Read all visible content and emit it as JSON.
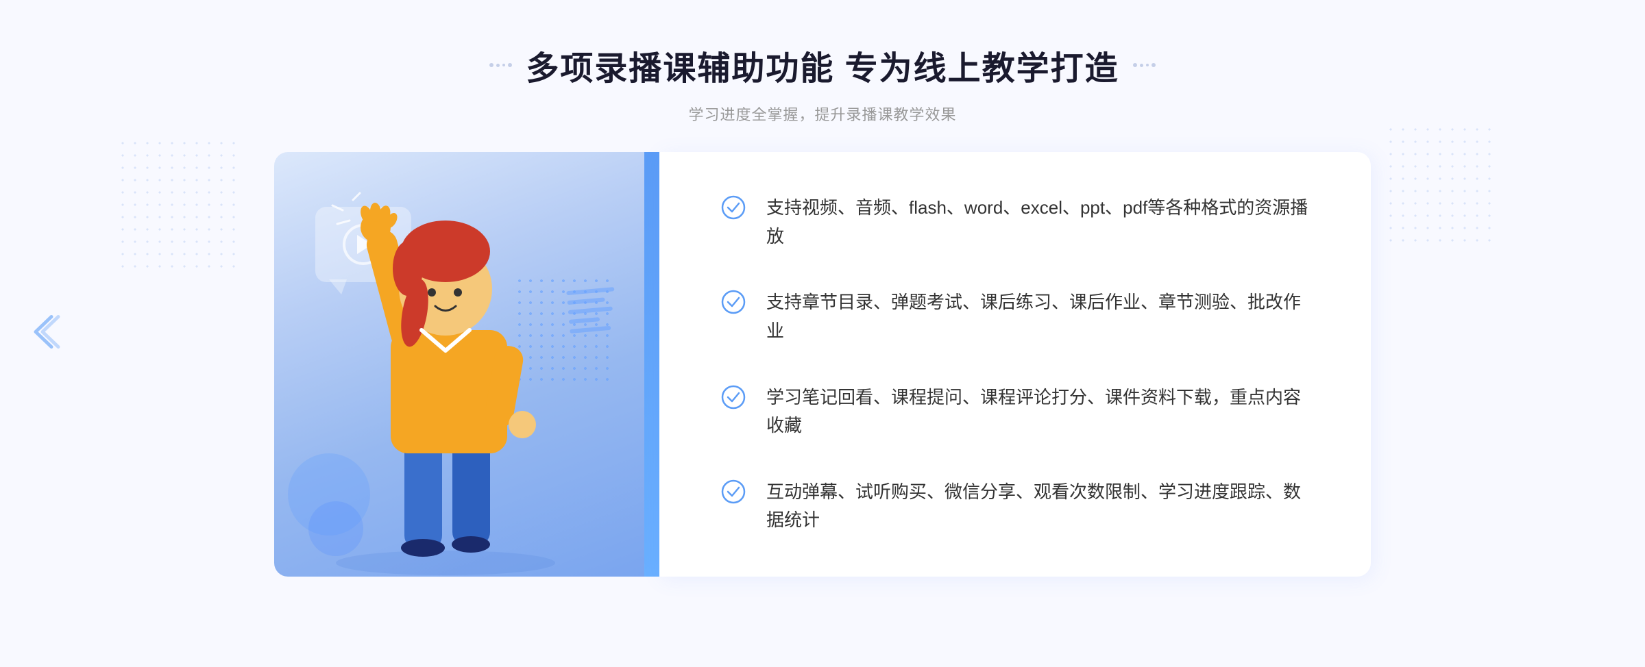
{
  "page": {
    "background_color": "#f0f4fd"
  },
  "header": {
    "title": "多项录播课辅助功能 专为线上教学打造",
    "subtitle": "学习进度全掌握，提升录播课教学效果",
    "decorator_left": "❖",
    "decorator_right": "❖"
  },
  "features": [
    {
      "id": "feature-1",
      "text": "支持视频、音频、flash、word、excel、ppt、pdf等各种格式的资源播放"
    },
    {
      "id": "feature-2",
      "text": "支持章节目录、弹题考试、课后练习、课后作业、章节测验、批改作业"
    },
    {
      "id": "feature-3",
      "text": "学习笔记回看、课程提问、课程评论打分、课件资料下载，重点内容收藏"
    },
    {
      "id": "feature-4",
      "text": "互动弹幕、试听购买、微信分享、观看次数限制、学习进度跟踪、数据统计"
    }
  ],
  "icons": {
    "check": "check-circle-icon",
    "play": "play-icon",
    "chevron_left": "chevron-left-icon"
  },
  "colors": {
    "primary_blue": "#5b9cf6",
    "light_blue": "#a8c8ff",
    "text_dark": "#333333",
    "text_light": "#999999",
    "accent_blue": "#4a8af0"
  }
}
